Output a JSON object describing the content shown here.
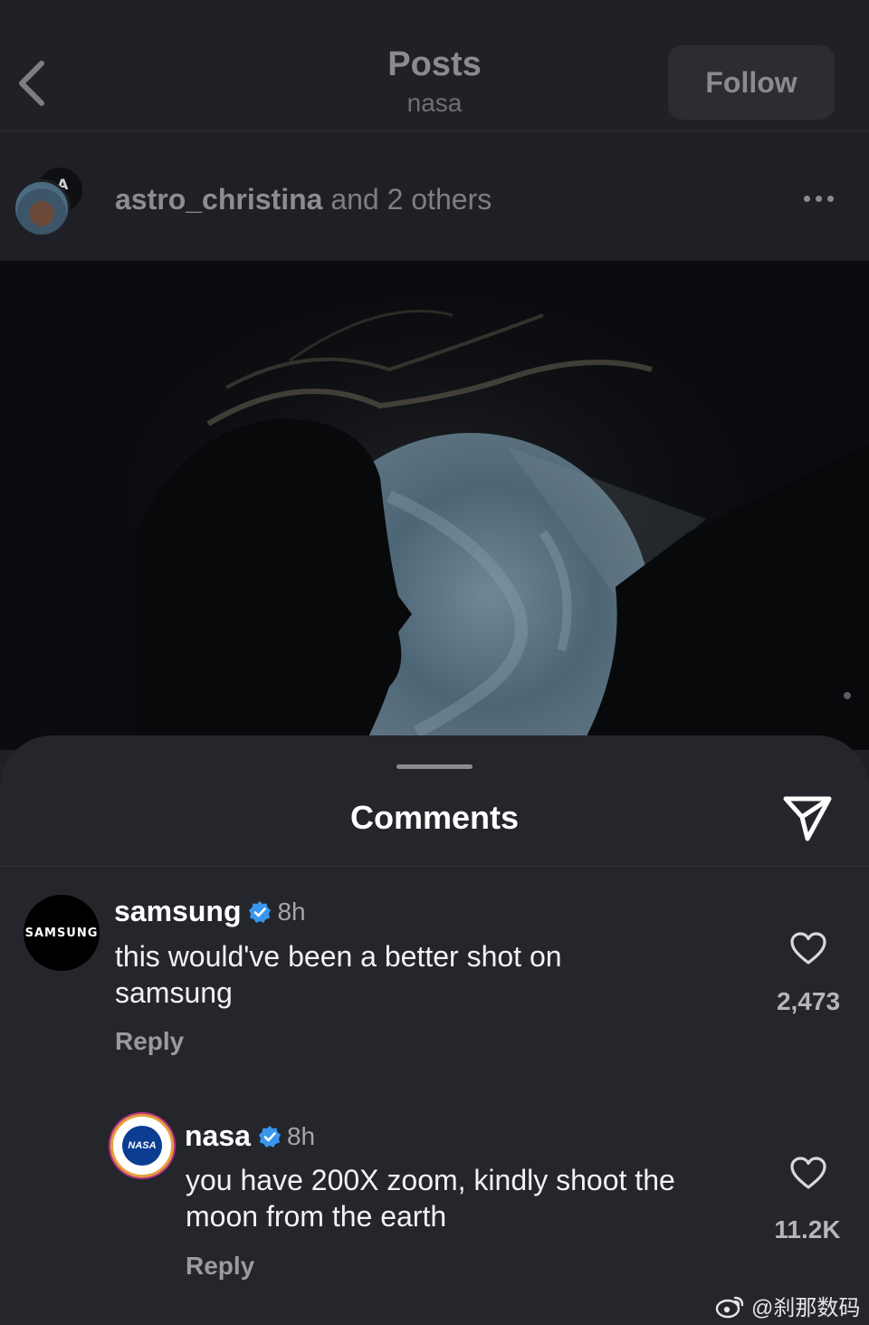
{
  "header": {
    "title": "Posts",
    "subtitle": "nasa",
    "follow_label": "Follow"
  },
  "author": {
    "name": "astro_christina",
    "rest": " and 2 others"
  },
  "comments_sheet": {
    "title": "Comments",
    "comments": [
      {
        "user": "samsung",
        "avatar_text": "SAMSUNG",
        "time": "8h",
        "text_line1": "this would've been a better shot on",
        "text_line2": "samsung",
        "reply_label": "Reply",
        "likes": "2,473"
      },
      {
        "user": "nasa",
        "avatar_text": "NASA",
        "time": "8h",
        "text_line1": "you have 200X zoom, kindly shoot the",
        "text_line2": "moon from the earth",
        "reply_label": "Reply",
        "likes": "11.2K"
      }
    ]
  },
  "watermark": "@刹那数码",
  "colors": {
    "verified": "#3797f0",
    "sheet_bg": "#25262c"
  },
  "icons": [
    "back-icon",
    "more-icon",
    "share-icon",
    "verified-icon",
    "heart-icon",
    "weibo-icon"
  ]
}
